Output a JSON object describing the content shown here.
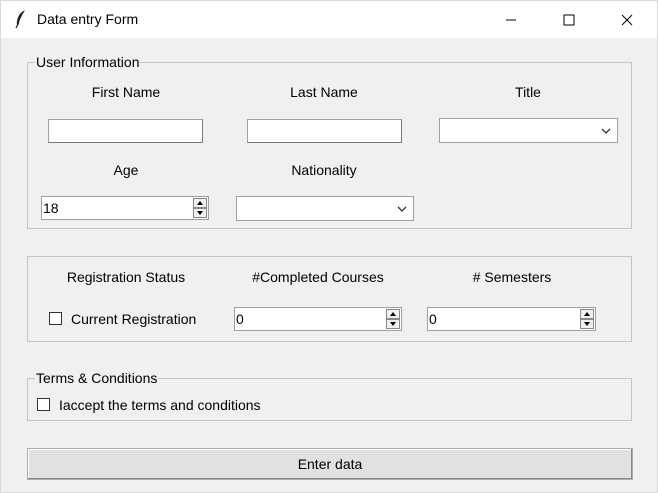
{
  "window": {
    "title": "Data entry Form",
    "icon": "feather-icon"
  },
  "user_info": {
    "legend": "User Information",
    "first_name_label": "First Name",
    "first_name_value": "",
    "last_name_label": "Last Name",
    "last_name_value": "",
    "title_label": "Title",
    "title_value": "",
    "age_label": "Age",
    "age_value": "18",
    "nationality_label": "Nationality",
    "nationality_value": ""
  },
  "courses": {
    "registration_status_label": "Registration Status",
    "current_registration_label": "Current Registration",
    "completed_courses_label": "#Completed Courses",
    "completed_courses_value": "0",
    "semesters_label": "# Semesters",
    "semesters_value": "0"
  },
  "terms": {
    "legend": "Terms & Conditions",
    "accept_label": "Iaccept the terms and conditions"
  },
  "submit": {
    "label": "Enter data"
  }
}
